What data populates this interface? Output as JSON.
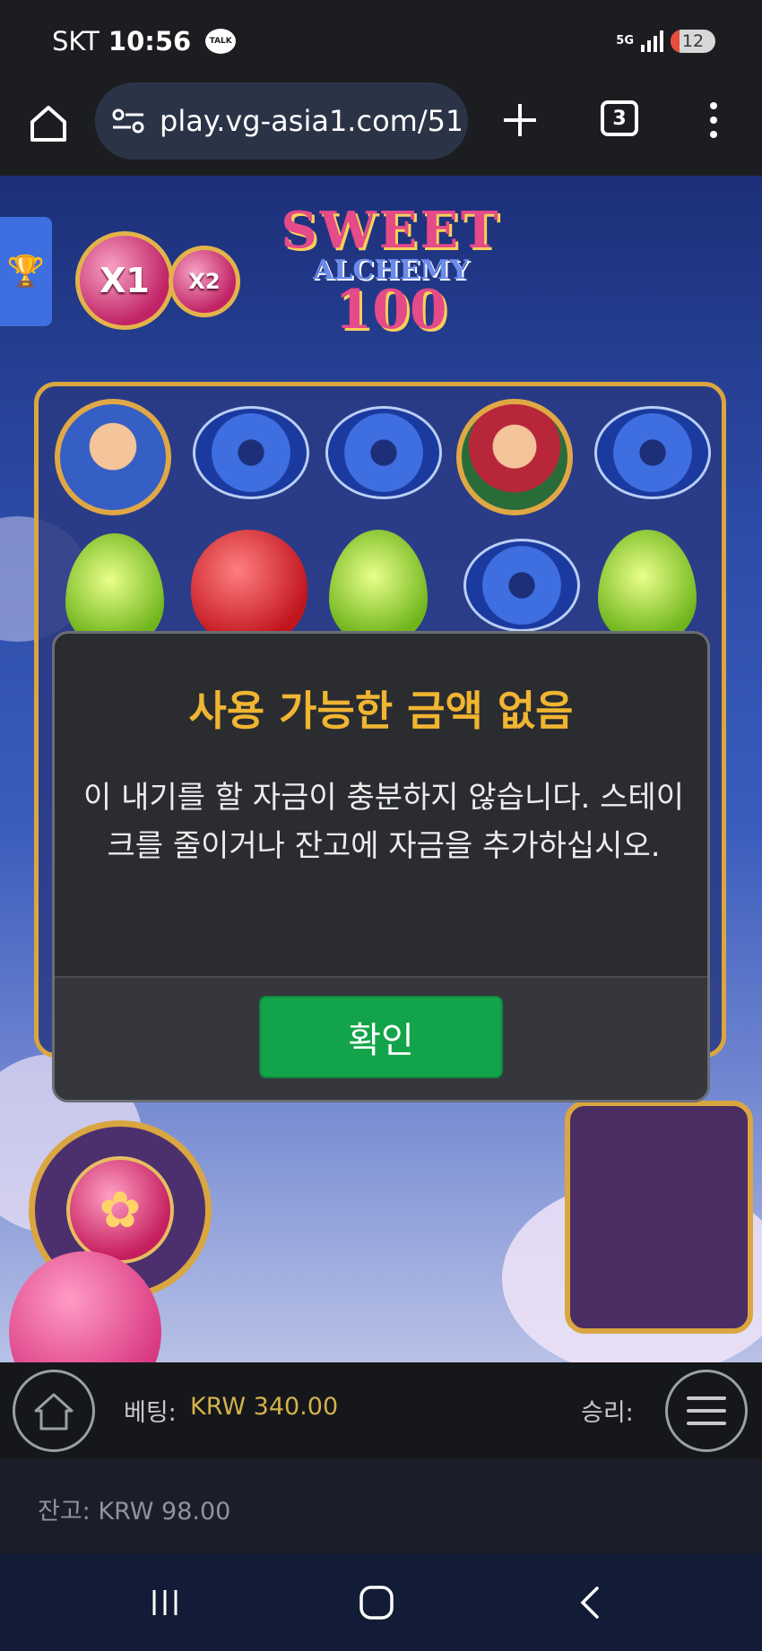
{
  "status_bar": {
    "carrier": "SKT",
    "time": "10:56",
    "notification_icon": "kakaotalk-icon",
    "talk_label": "TALK",
    "network": "5G",
    "battery": "12"
  },
  "browser": {
    "url": "play.vg-asia1.com/51",
    "tab_count": "3"
  },
  "game": {
    "logo_line1": "SWEET",
    "logo_line2": "ALCHEMY",
    "logo_line3": "100",
    "multipliers": [
      "X1",
      "X2"
    ]
  },
  "modal": {
    "title": "사용 가능한 금액 없음",
    "message": "이 내기를 할 자금이 충분하지 않습니다. 스테이크를 줄이거나 잔고에 자금을 추가하십시오.",
    "confirm_label": "확인",
    "confirm_color": "#13a34a",
    "title_color": "#f0b531"
  },
  "bet_bar": {
    "bet_label": "베팅:",
    "bet_value": "KRW 340.00",
    "win_label": "승리:"
  },
  "balance": {
    "label": "잔고: KRW 98.00"
  }
}
